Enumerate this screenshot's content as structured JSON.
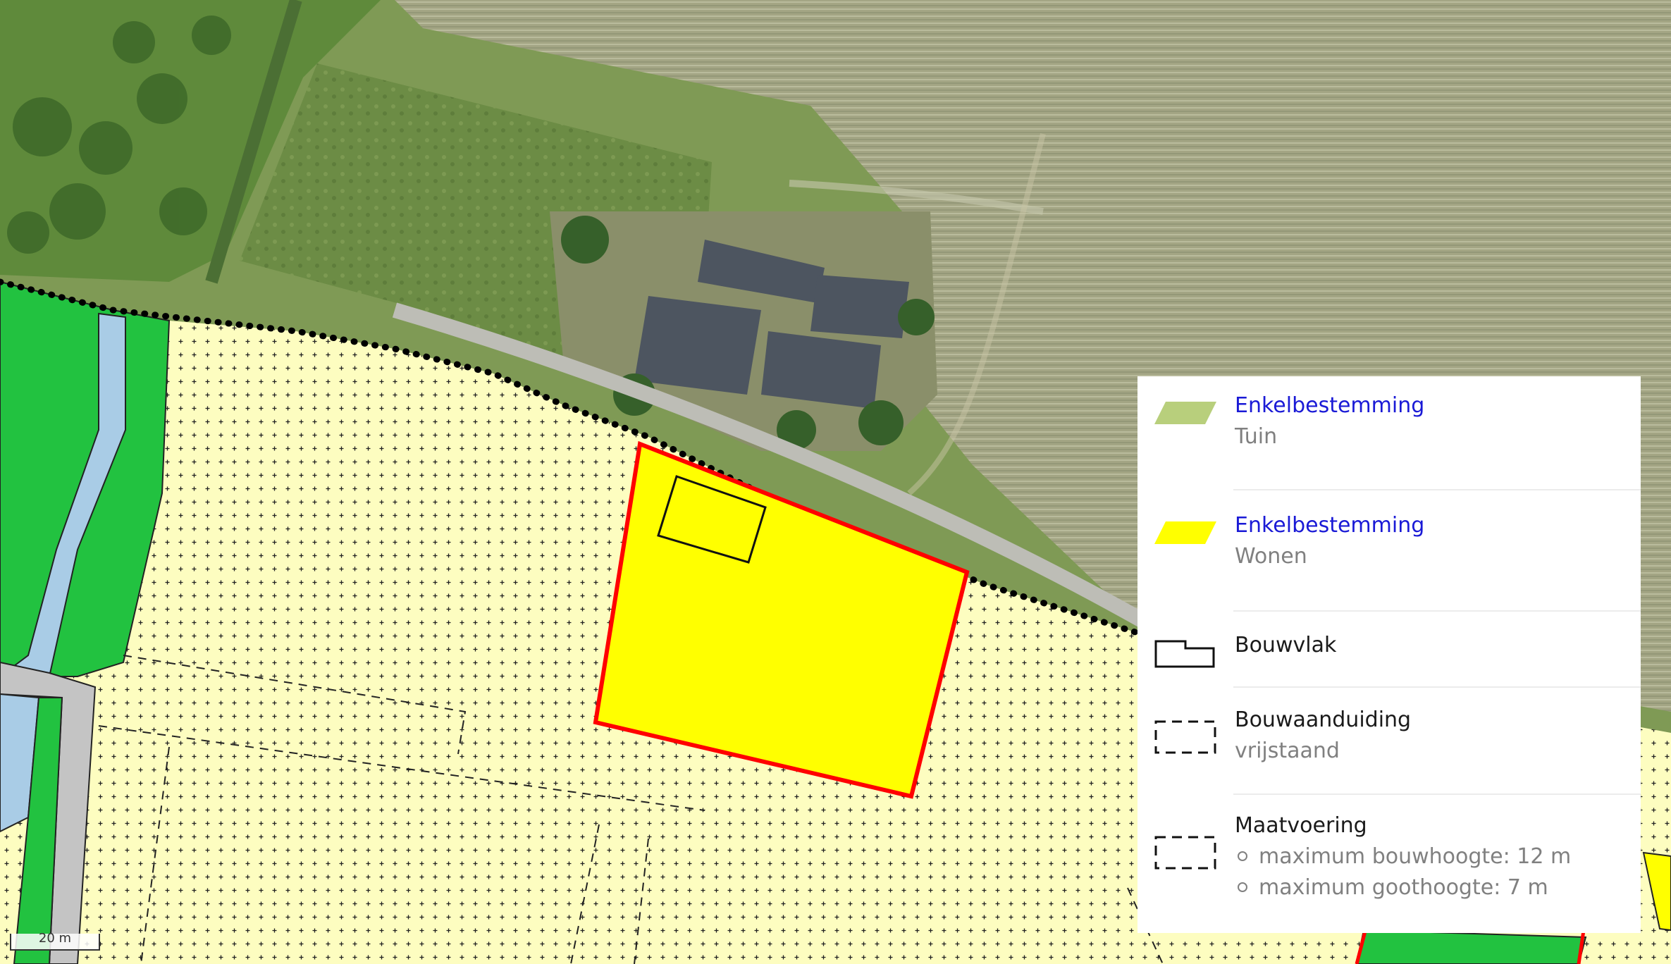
{
  "legend": {
    "items": [
      {
        "title": "Enkelbestemming",
        "subtitle": "Tuin",
        "symbol": "tuin-swatch",
        "color": "#b8cf7c"
      },
      {
        "title": "Enkelbestemming",
        "subtitle": "Wonen",
        "symbol": "wonen-swatch",
        "color": "#ffff00"
      },
      {
        "title": "Bouwvlak",
        "symbol": "bouwvlak-outline"
      },
      {
        "title": "Bouwaanduiding",
        "subtitle": "vrijstaand",
        "symbol": "dashed-rect"
      },
      {
        "title": "Maatvoering",
        "symbol": "dashed-rect",
        "bullets": [
          "maximum bouwhoogte: 12 m",
          "maximum goothoogte: 7 m"
        ]
      }
    ]
  },
  "scale": {
    "label": "20 m"
  },
  "colors": {
    "field": "#a9ac8a",
    "meadow": "#6f8f45",
    "agrarisch": "#fdfdc0",
    "groen": "#22c240",
    "water": "#a9cce6",
    "verkeer": "#c4c4c4",
    "wonen": "#ffff00",
    "tuin": "#b8cf7c",
    "selection": "#ff0000"
  }
}
